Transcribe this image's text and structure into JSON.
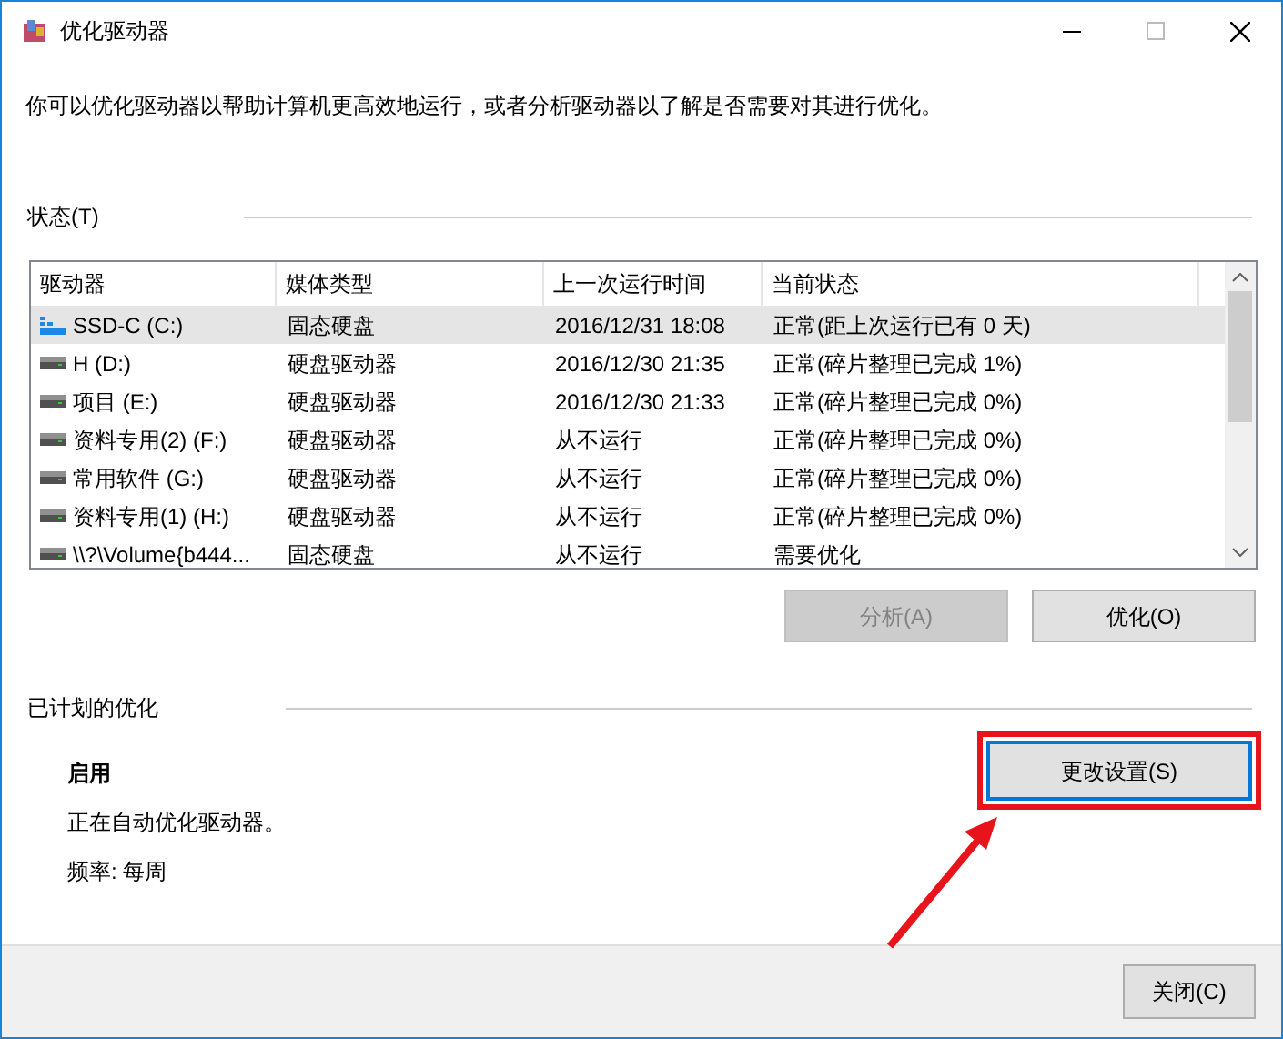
{
  "window": {
    "title": "优化驱动器"
  },
  "description": "你可以优化驱动器以帮助计算机更高效地运行，或者分析驱动器以了解是否需要对其进行优化。",
  "status_section": {
    "label": "状态(T)"
  },
  "table": {
    "columns": [
      "驱动器",
      "媒体类型",
      "上一次运行时间",
      "当前状态"
    ],
    "rows": [
      {
        "kind": "ssd",
        "selected": true,
        "cells": [
          "SSD-C (C:)",
          "固态硬盘",
          "2016/12/31 18:08",
          "正常(距上次运行已有 0 天)"
        ]
      },
      {
        "kind": "hdd",
        "selected": false,
        "cells": [
          "H (D:)",
          "硬盘驱动器",
          "2016/12/30 21:35",
          "正常(碎片整理已完成 1%)"
        ]
      },
      {
        "kind": "hdd",
        "selected": false,
        "cells": [
          "项目 (E:)",
          "硬盘驱动器",
          "2016/12/30 21:33",
          "正常(碎片整理已完成 0%)"
        ]
      },
      {
        "kind": "hdd",
        "selected": false,
        "cells": [
          "资料专用(2) (F:)",
          "硬盘驱动器",
          "从不运行",
          "正常(碎片整理已完成 0%)"
        ]
      },
      {
        "kind": "hdd",
        "selected": false,
        "cells": [
          "常用软件 (G:)",
          "硬盘驱动器",
          "从不运行",
          "正常(碎片整理已完成 0%)"
        ]
      },
      {
        "kind": "hdd",
        "selected": false,
        "cells": [
          "资料专用(1) (H:)",
          "硬盘驱动器",
          "从不运行",
          "正常(碎片整理已完成 0%)"
        ]
      },
      {
        "kind": "hdd",
        "selected": false,
        "cells": [
          "\\\\?\\Volume{b444...",
          "固态硬盘",
          "从不运行",
          "需要优化"
        ]
      }
    ]
  },
  "actions": [
    {
      "label": "分析(A)",
      "disabled": true
    },
    {
      "label": "优化(O)",
      "disabled": false
    }
  ],
  "scheduled": {
    "label": "已计划的优化",
    "state": "启用",
    "info": "正在自动优化驱动器。",
    "frequency": "频率: 每周",
    "button": "更改设置(S)"
  },
  "close_button": "关闭(C)"
}
